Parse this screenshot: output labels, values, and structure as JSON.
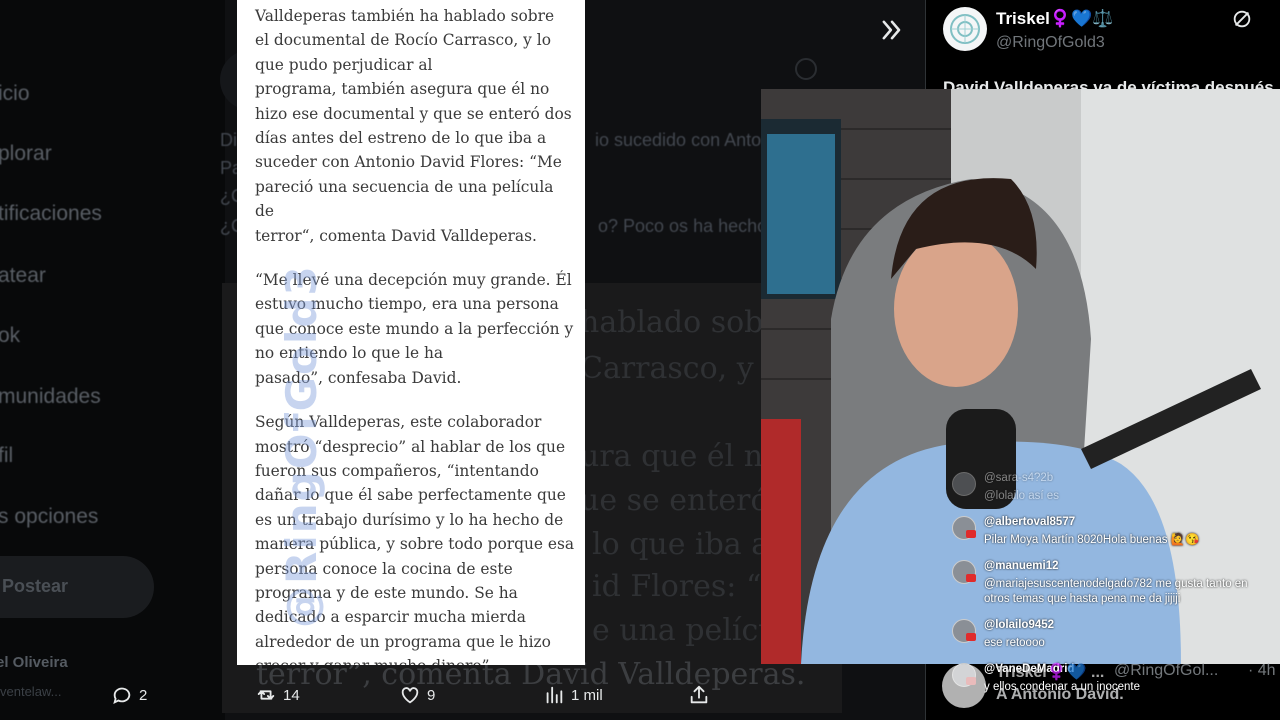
{
  "sidebar": {
    "items": [
      "icio",
      "plorar",
      "tificaciones",
      "atear",
      "ok",
      "munidades",
      "fil",
      "s opciones"
    ],
    "post_label": "Postear",
    "user_name": "el Oliveira",
    "user_handle": "ventelaw..."
  },
  "feed": {
    "lines": [
      "Di",
      "io sucedido con Anto",
      "Pa",
      "¿C",
      "¿C",
      "o? Poco os ha hecho"
    ],
    "image_overlay_lines": [
      "hablado sobr",
      "Carrasco, y lo",
      "ura que él no",
      "ue se enteró d",
      "lo que iba a",
      "id Flores: “M",
      "e una película",
      "terror”, comenta David Valldeperas."
    ]
  },
  "article": {
    "paragraphs": [
      "Valldeperas también ha hablado sobre\nel documental de Rocío Carrasco, y lo\nque pudo perjudicar al\nprograma, también asegura que él no\nhizo ese documental y que se enteró dos\ndías antes del estreno de lo que iba a\nsuceder con Antonio David Flores: “Me\npareció una secuencia de una película de\nterror“, comenta David Valldeperas.",
      "“Me llevé una decepción muy grande. Él\nestuvo mucho tiempo, era una persona\nque conoce este mundo a la perfección y\nno entiendo lo que le ha\npasado”, confesaba David.",
      "Según Valldeperas, este colaborador\nmostró “desprecio” al hablar de los que\nfueron sus compañeros, “intentando\ndañar lo que él sabe perfectamente que\nes un trabajo durísimo y lo ha hecho de\nmanera pública, y sobre todo porque esa\npersona conoce la cocina de este\nprograma y de este mundo. Se ha\ndedicado a esparcir mucha mierda\nalrededor de un programa que le hizo\ncrecer y ganar mucho dinero”."
    ],
    "watermark": "@RingOfGold3"
  },
  "actions": {
    "replies": "2",
    "reposts": "14",
    "likes": "9",
    "views": "1 mil"
  },
  "right": {
    "author_name": "Triskel",
    "author_emoji": "♀️💙⚖️",
    "author_handle": "@RingOfGold3",
    "headline": "David Valldeperas va de víctima después"
  },
  "chat": [
    {
      "user": "@sara-s4?2b",
      "text": "@lolailo así es",
      "faded": true
    },
    {
      "user": "@albertoval8577",
      "text": "Pilar Moya Martín 8020Hola buenas 🙋😘"
    },
    {
      "user": "@manuemi12",
      "text": "@mariajesuscentenodelgado782 me gusta tanto en otros temas que hasta pena me da jijiji"
    },
    {
      "user": "@lolailo9452",
      "text": "ese retoooo"
    },
    {
      "user": "@VaneDeMadrid",
      "text": "y ellos condenar a un inocente"
    }
  ],
  "bottom": {
    "name": "Triskel♀️💙 ...",
    "handle": "@RingOfGol...",
    "time": "· 4h",
    "text": "A Antonio David."
  },
  "colors": {
    "background": "#000000",
    "article_bg": "#ffffff",
    "watermark": "#82a0dc",
    "text_primary": "#e7e9ea",
    "text_muted": "#71767b",
    "chat_badge": "#e02b2b"
  }
}
